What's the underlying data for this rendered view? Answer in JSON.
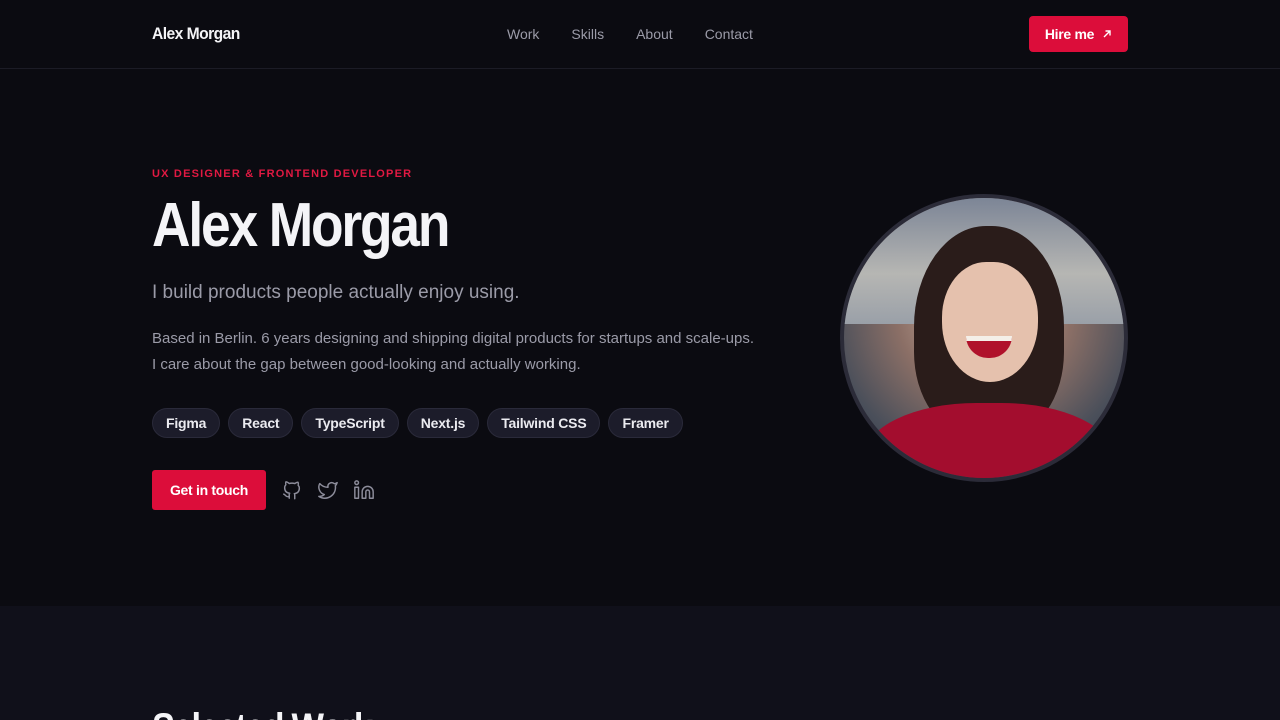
{
  "header": {
    "brand": "Alex Morgan",
    "nav": [
      "Work",
      "Skills",
      "About",
      "Contact"
    ],
    "hire_label": "Hire me"
  },
  "hero": {
    "eyebrow": "UX DESIGNER & FRONTEND DEVELOPER",
    "title": "Alex Morgan",
    "tagline": "I build products people actually enjoy using.",
    "bio_line1": "Based in Berlin. 6 years designing and shipping digital products for startups and scale-ups.",
    "bio_line2": "I care about the gap between good-looking and actually working.",
    "skills": [
      "Figma",
      "React",
      "TypeScript",
      "Next.js",
      "Tailwind CSS",
      "Framer"
    ],
    "cta_label": "Get in touch",
    "social_icons": [
      "github-icon",
      "twitter-icon",
      "linkedin-icon"
    ]
  },
  "next_section": {
    "title": "Selected Work"
  },
  "colors": {
    "accent": "#dc0d3a",
    "background": "#0b0b11",
    "text_muted": "#9b9ba8"
  }
}
